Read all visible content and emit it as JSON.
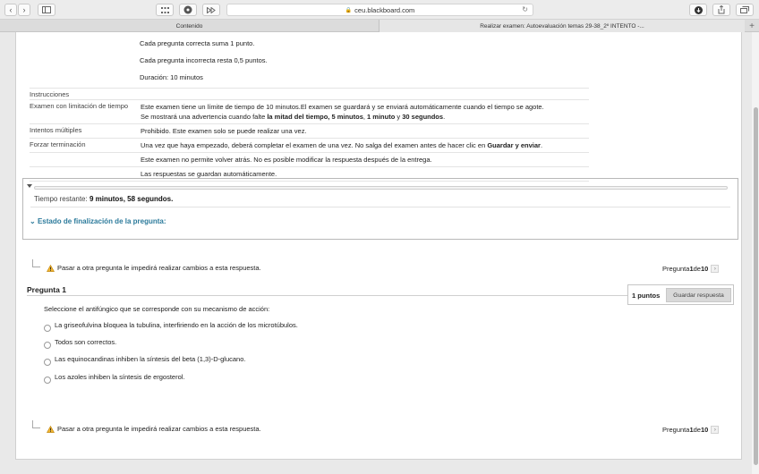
{
  "browser": {
    "url": "ceu.blackboard.com",
    "tabs": [
      {
        "label": "Contenido"
      },
      {
        "label": "Realizar examen: Autoevaluación temas 29-38_2º INTENTO -..."
      }
    ]
  },
  "exam_info": {
    "rules": [
      "Cada pregunta correcta suma 1 punto.",
      "Cada pregunta incorrecta resta 0,5 puntos.",
      "Duración: 10 minutos"
    ],
    "instrucciones_label": "Instrucciones",
    "limite_label": "Examen con limitación de tiempo",
    "limite_text_1": "Este examen tiene un límite de tiempo de 10 minutos.El examen se guardará y se enviará automáticamente cuando el tiempo se agote.",
    "limite_text_2a": "Se mostrará una advertencia cuando falte ",
    "limite_text_2b": "la mitad del tiempo, 5 minutos",
    "limite_text_2c": ", ",
    "limite_text_2d": "1 minuto",
    "limite_text_2e": " y ",
    "limite_text_2f": "30 segundos",
    "limite_text_2g": ".",
    "intentos_label": "Intentos múltiples",
    "intentos_text": "Prohibido. Este examen solo se puede realizar una vez.",
    "forzar_label": "Forzar terminación",
    "forzar_text_a": "Una vez que haya empezado, deberá completar el examen de una vez. No salga del examen antes de hacer clic en ",
    "forzar_text_b": "Guardar y enviar",
    "forzar_text_c": ".",
    "no_volver_text": "Este examen no permite volver atrás. No es posible modificar la respuesta después de la entrega.",
    "autosave_text": "Las respuestas se guardan automáticamente."
  },
  "status": {
    "time_label": "Tiempo restante: ",
    "time_minutes": "9 minutos, 58 segundos.",
    "estado_label": "Estado de finalización de la pregunta:"
  },
  "navigation": {
    "warning": "Pasar a otra pregunta le impedirá realizar cambios a esta respuesta.",
    "pager_prefix": "Pregunta ",
    "pager_current": "1",
    "pager_mid": " de ",
    "pager_total": "10"
  },
  "question": {
    "title": "Pregunta 1",
    "points": "1 puntos",
    "save_label": "Guardar respuesta",
    "prompt": "Seleccione el antifúngico que se corresponde con su mecanismo de acción:",
    "options": [
      "La griseofulvina bloquea la tubulina, interfiriendo en la acción de los microtúbulos.",
      "Todos son correctos.",
      "Las equinocandinas inhiben la síntesis del beta (1,3)-D-glucano.",
      "Los azoles inhiben la síntesis de ergosterol."
    ]
  }
}
